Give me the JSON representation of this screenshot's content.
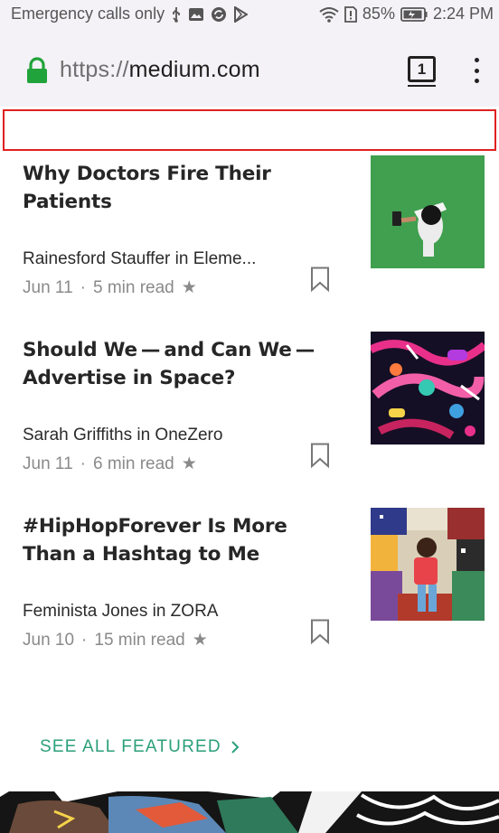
{
  "status_bar": {
    "carrier": "Emergency calls only",
    "battery": "85%",
    "time": "2:24 PM",
    "icons": [
      "usb-icon",
      "image-icon",
      "sync-icon",
      "play-store-icon",
      "wifi-icon",
      "sim-alert-icon",
      "battery-icon"
    ]
  },
  "address_bar": {
    "url_scheme": "https://",
    "url_host": "medium.com",
    "tab_count": "1",
    "lock_color": "#21a33b"
  },
  "articles": [
    {
      "title": "Why Doctors Fire Their Patients",
      "author": "Rainesford Stauffer in Eleme...",
      "date": "Jun 11",
      "read_time": "5 min read"
    },
    {
      "title": "Should We — and Can We — Advertise in Space?",
      "author": "Sarah Griffiths in OneZero",
      "date": "Jun 11",
      "read_time": "6 min read"
    },
    {
      "title": "#HipHopForever Is More Than a Hashtag to Me",
      "author": "Feminista Jones in ZORA",
      "date": "Jun 10",
      "read_time": "15 min read"
    }
  ],
  "see_all": {
    "label": "SEE ALL FEATURED",
    "color": "#2b9f7a"
  },
  "highlight_color": "#e02020"
}
